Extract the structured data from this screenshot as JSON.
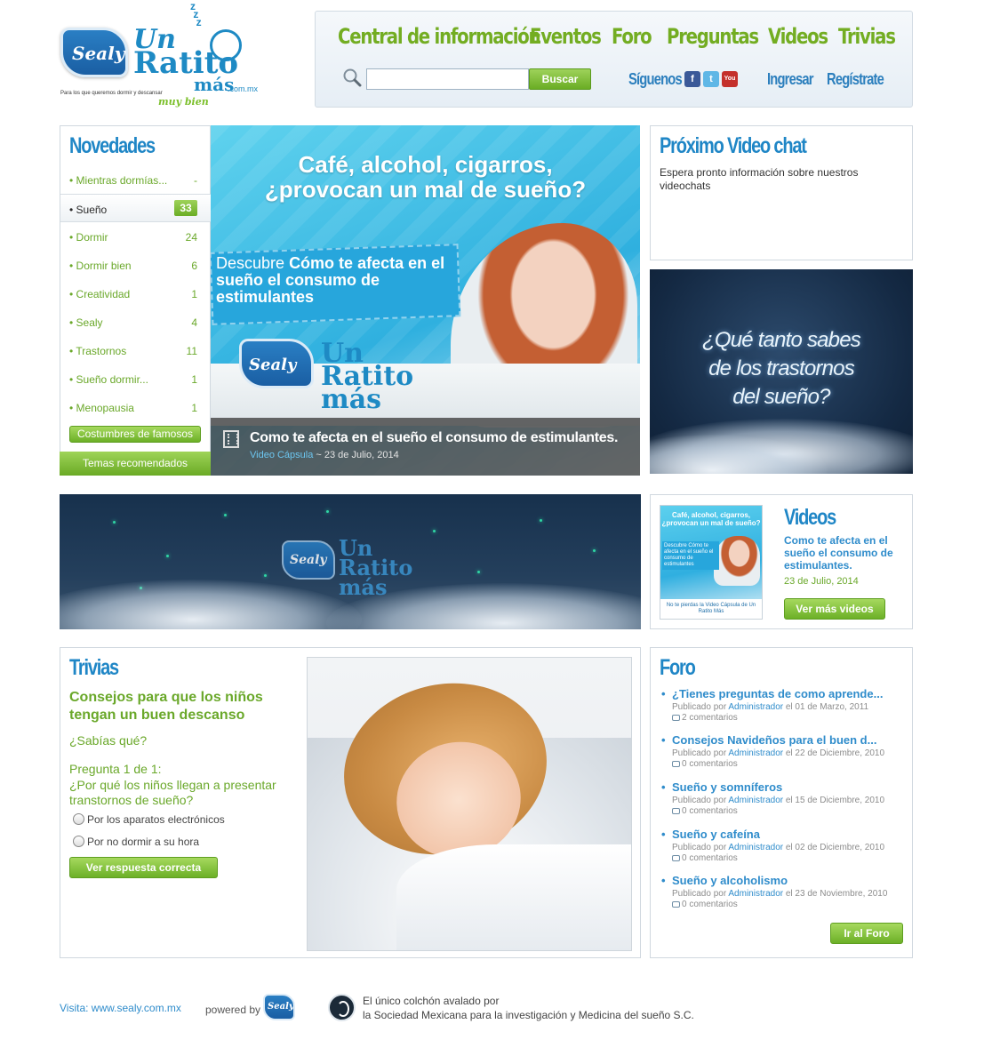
{
  "brand": {
    "logo_sealy": "Sealy",
    "logo_un": "Un",
    "logo_ratito": "Ratito",
    "logo_mas": "más",
    "logo_domain": ".com.mx",
    "tagline": "Para los que queremos dormir y descansar",
    "tagline_accent": "muy bien",
    "primary_color": "#1f86c6",
    "accent_color": "#73ad22"
  },
  "nav": {
    "links": [
      "Central de información",
      "Eventos",
      "Foro",
      "Preguntas",
      "Videos",
      "Trivias"
    ],
    "search_placeholder": "",
    "search_button": "Buscar",
    "follow_label": "Síguenos",
    "social": [
      "facebook-icon",
      "twitter-icon",
      "youtube-icon"
    ],
    "social_glyphs": [
      "f",
      "t",
      "You"
    ],
    "login": "Ingresar",
    "register": "Regístrate"
  },
  "novedades": {
    "title": "Novedades",
    "items": [
      {
        "label": "• Mientras dormías...",
        "count": "-"
      },
      {
        "label": "• Sueño",
        "count": "33",
        "active": true
      },
      {
        "label": "• Dormir",
        "count": "24"
      },
      {
        "label": "• Dormir bien",
        "count": "6"
      },
      {
        "label": "• Creatividad",
        "count": "1"
      },
      {
        "label": "• Sealy",
        "count": "4"
      },
      {
        "label": "• Trastornos",
        "count": "11"
      },
      {
        "label": "• Sueño dormir...",
        "count": "1"
      },
      {
        "label": "• Menopausia",
        "count": "1"
      }
    ],
    "tag_button": "Costumbres de famosos",
    "footer_button": "Temas recomendados"
  },
  "hero": {
    "headline_line1": "Café, alcohol, cigarros,",
    "headline_line2": "¿provocan un mal de sueño?",
    "ribbon_prefix": "Descubre",
    "ribbon_text": "Cómo te afecta en el sueño el consumo de estimulantes",
    "mini_logo_sealy": "Sealy",
    "mini_logo_text": "Un Ratito más",
    "caption_title": "Como te afecta en el sueño el consumo de estimulantes.",
    "caption_category": "Video Cápsula",
    "caption_date": " ~ 23 de Julio, 2014"
  },
  "videochat": {
    "title": "Próximo Video chat",
    "text": "Espera pronto información sobre nuestros videochats"
  },
  "trastornos_banner": {
    "line1": "¿Qué tanto sabes",
    "line2": "de los trastornos",
    "line3": "del sueño?"
  },
  "wide_banner": {
    "logo_sealy": "Sealy",
    "logo_text": "Un Ratito más"
  },
  "videos": {
    "title": "Videos",
    "thumb_headline": "Café, alcohol, cigarros, ¿provocan un mal de sueño?",
    "thumb_ribbon": "Descubre Cómo te afecta en el sueño el consumo de estimulantes",
    "thumb_footer": "No te pierdas la Video Cápsula de Un Ratito Más",
    "item_title": "Como te afecta en el sueño el consumo de estimulantes.",
    "item_date": "23 de Julio, 2014",
    "more_button": "Ver más videos"
  },
  "trivias": {
    "title": "Trivias",
    "subtitle": "Consejos para que los niños tengan un buen descanso",
    "sabias": "¿Sabías qué?",
    "question_counter": "Pregunta 1 de 1:",
    "question": "¿Por qué los niños llegan a presentar transtornos de sueño?",
    "options": [
      "Por los aparatos electrónicos",
      "Por no dormir a su hora"
    ],
    "answer_button": "Ver respuesta correcta"
  },
  "foro": {
    "title": "Foro",
    "posts": [
      {
        "title": "¿Tienes preguntas de como aprende...",
        "by": "Publicado por ",
        "author": "Administrador",
        "date": " el 01 de Marzo, 2011",
        "comments": "2 comentarios"
      },
      {
        "title": "Consejos Navideños para el buen d...",
        "by": "Publicado por ",
        "author": "Administrador",
        "date": " el 22 de Diciembre, 2010",
        "comments": "0 comentarios"
      },
      {
        "title": "Sueño y somníferos",
        "by": "Publicado por ",
        "author": "Administrador",
        "date": " el 15 de Diciembre, 2010",
        "comments": "0 comentarios"
      },
      {
        "title": "Sueño y cafeína",
        "by": "Publicado por ",
        "author": "Administrador",
        "date": " el 02 de Diciembre, 2010",
        "comments": "0 comentarios"
      },
      {
        "title": "Sueño y alcoholismo",
        "by": "Publicado por ",
        "author": "Administrador",
        "date": " el 23 de Noviembre, 2010",
        "comments": "0 comentarios"
      }
    ],
    "button": "Ir al Foro"
  },
  "footer": {
    "visit": "Visita: www.sealy.com.mx",
    "powered_by": "powered by",
    "sealy_mini": "Sealy",
    "seal_line1": "El único colchón avalado por",
    "seal_line2": "la Sociedad Mexicana para la investigación y Medicina del sueño S.C."
  }
}
